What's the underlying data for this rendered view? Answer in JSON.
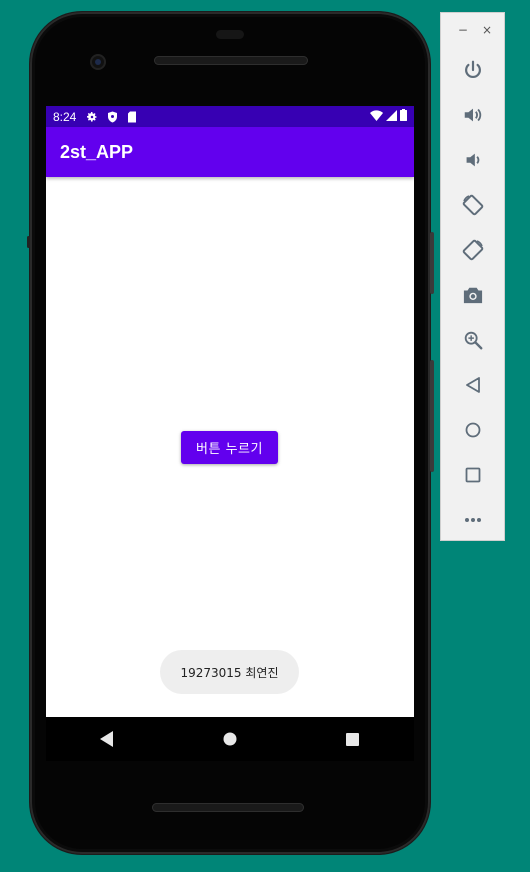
{
  "status_bar": {
    "time": "8:24",
    "icons": [
      "gear-icon",
      "shield-icon",
      "sd-card-icon",
      "wifi-icon",
      "signal-icon",
      "battery-icon"
    ],
    "color": "#3700b3"
  },
  "app_bar": {
    "title": "2st_APP",
    "color": "#6200ee"
  },
  "main": {
    "button_label": "버튼 누르기",
    "toast_text": "19273015 최연진"
  },
  "nav_bar": {
    "items": [
      "back-icon",
      "home-icon",
      "recents-icon"
    ]
  },
  "emulator_toolbar": {
    "window_controls": [
      "−",
      "×"
    ],
    "items": [
      "power-icon",
      "volume-up-icon",
      "volume-down-icon",
      "rotate-left-icon",
      "rotate-right-icon",
      "camera-icon",
      "zoom-icon",
      "back-icon",
      "home-icon",
      "overview-icon",
      "more-icon"
    ],
    "icon_color": "#5f6d7a"
  },
  "colors": {
    "background": "#008577",
    "accent": "#6200ee"
  }
}
